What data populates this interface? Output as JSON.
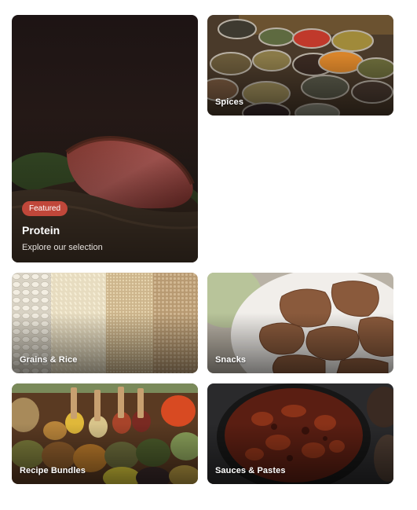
{
  "categories": {
    "protein": {
      "badge": "Featured",
      "title": "Protein",
      "subtitle": "Explore our selection"
    },
    "spices": {
      "label": "Spices"
    },
    "grains": {
      "label": "Grains & Rice"
    },
    "snacks": {
      "label": "Snacks"
    },
    "bundles": {
      "label": "Recipe Bundles"
    },
    "sauces": {
      "label": "Sauces & Pastes"
    }
  },
  "colors": {
    "badge": "#c0473a",
    "background": "#ffffff",
    "label_text": "#ffffff"
  }
}
